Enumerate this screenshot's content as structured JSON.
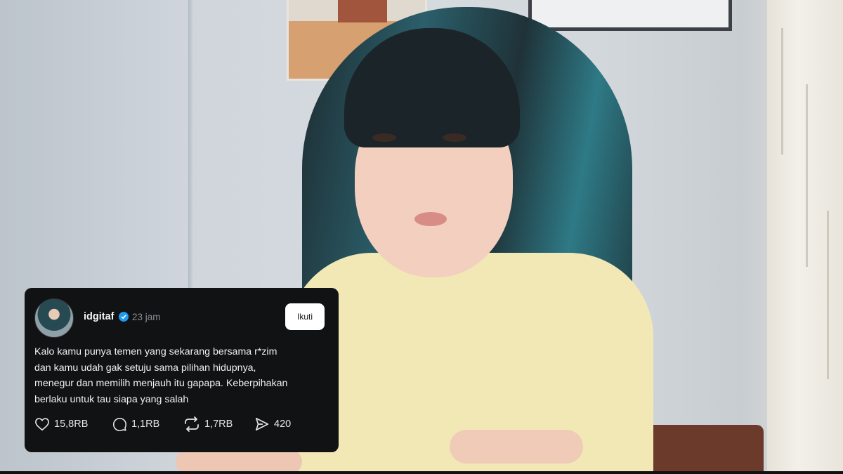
{
  "post": {
    "username": "idgitaf",
    "time": "23 jam",
    "follow_label": "Ikuti",
    "text_lines": [
      "Kalo kamu punya temen yang sekarang bersama r*zim",
      "dan kamu udah gak setuju sama pilihan hidupnya,",
      "menegur dan memilih menjauh itu gapapa. Keberpihakan",
      "berlaku untuk tau siapa yang salah"
    ],
    "stats": {
      "likes": "15,8RB",
      "replies": "1,1RB",
      "reposts": "1,7RB",
      "shares": "420"
    },
    "icons": {
      "like": "heart-icon",
      "reply": "comment-icon",
      "repost": "repost-icon",
      "share": "send-icon",
      "verified": "verified-badge-icon"
    }
  },
  "colors": {
    "card_bg": "#111214",
    "verified": "#1d9bf0",
    "follow_bg": "#ffffff"
  }
}
